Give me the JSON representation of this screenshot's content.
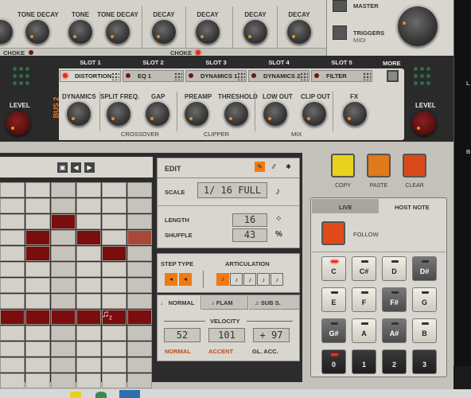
{
  "top": {
    "labels": [
      "TONE DECAY",
      "TONE",
      "TONE DECAY",
      "DECAY",
      "DECAY",
      "DECAY",
      "DECAY"
    ],
    "choke": [
      "CHOKE",
      "CHOKE"
    ],
    "master": "MASTER",
    "triggers": "TRIGGERS",
    "midi": "MIDI"
  },
  "slots": {
    "tabs": [
      "SLOT 1",
      "SLOT 2",
      "SLOT 3",
      "SLOT 4",
      "SLOT 5",
      "MORE"
    ],
    "selected": [
      "DISTORTION",
      "EQ 1",
      "DYNAMICS 1",
      "DYNAMICS 2",
      "FILTER"
    ]
  },
  "bus": {
    "label": "BUS 2",
    "level_left": "LEVEL",
    "level_right": "LEVEL",
    "knobs": [
      "DYNAMICS",
      "SPLIT FREQ.",
      "GAP",
      "PREAMP",
      "THRESHOLD",
      "LOW OUT",
      "CLIP OUT",
      "FX"
    ],
    "groups": [
      "CROSSOVER",
      "CLIPPER",
      "MIX"
    ]
  },
  "edit": {
    "title": "EDIT",
    "scale_label": "SCALE",
    "scale_value": "1/ 16 FULL",
    "length_label": "LENGTH",
    "length_value": "16",
    "shuffle_label": "SHUFFLE",
    "shuffle_value": "43",
    "step_type": "STEP TYPE",
    "articulation": "ARTICULATION",
    "modes": [
      "NORMAL",
      "FLAM",
      "SUB S."
    ],
    "velocity": "VELOCITY",
    "vel_values": [
      "52",
      "101",
      "+ 97"
    ],
    "vel_labels": [
      "NORMAL",
      "ACCENT",
      "GL. ACC."
    ],
    "step_note": "2"
  },
  "buttons": [
    "COPY",
    "PASTE",
    "CLEAR"
  ],
  "notes": {
    "tabs": [
      "LIVE",
      "HOST NOTE"
    ],
    "follow": "FOLLOW",
    "keys": [
      "C",
      "C#",
      "D",
      "D#",
      "E",
      "F",
      "F#",
      "G",
      "G#",
      "A",
      "A#",
      "B",
      "0",
      "1",
      "2",
      "3"
    ]
  },
  "colors": {
    "accent": "#f07a12",
    "step_on": "#7a0d0d",
    "copy": "#e8d21e",
    "paste": "#e07a1a",
    "clear": "#d84a1a"
  }
}
